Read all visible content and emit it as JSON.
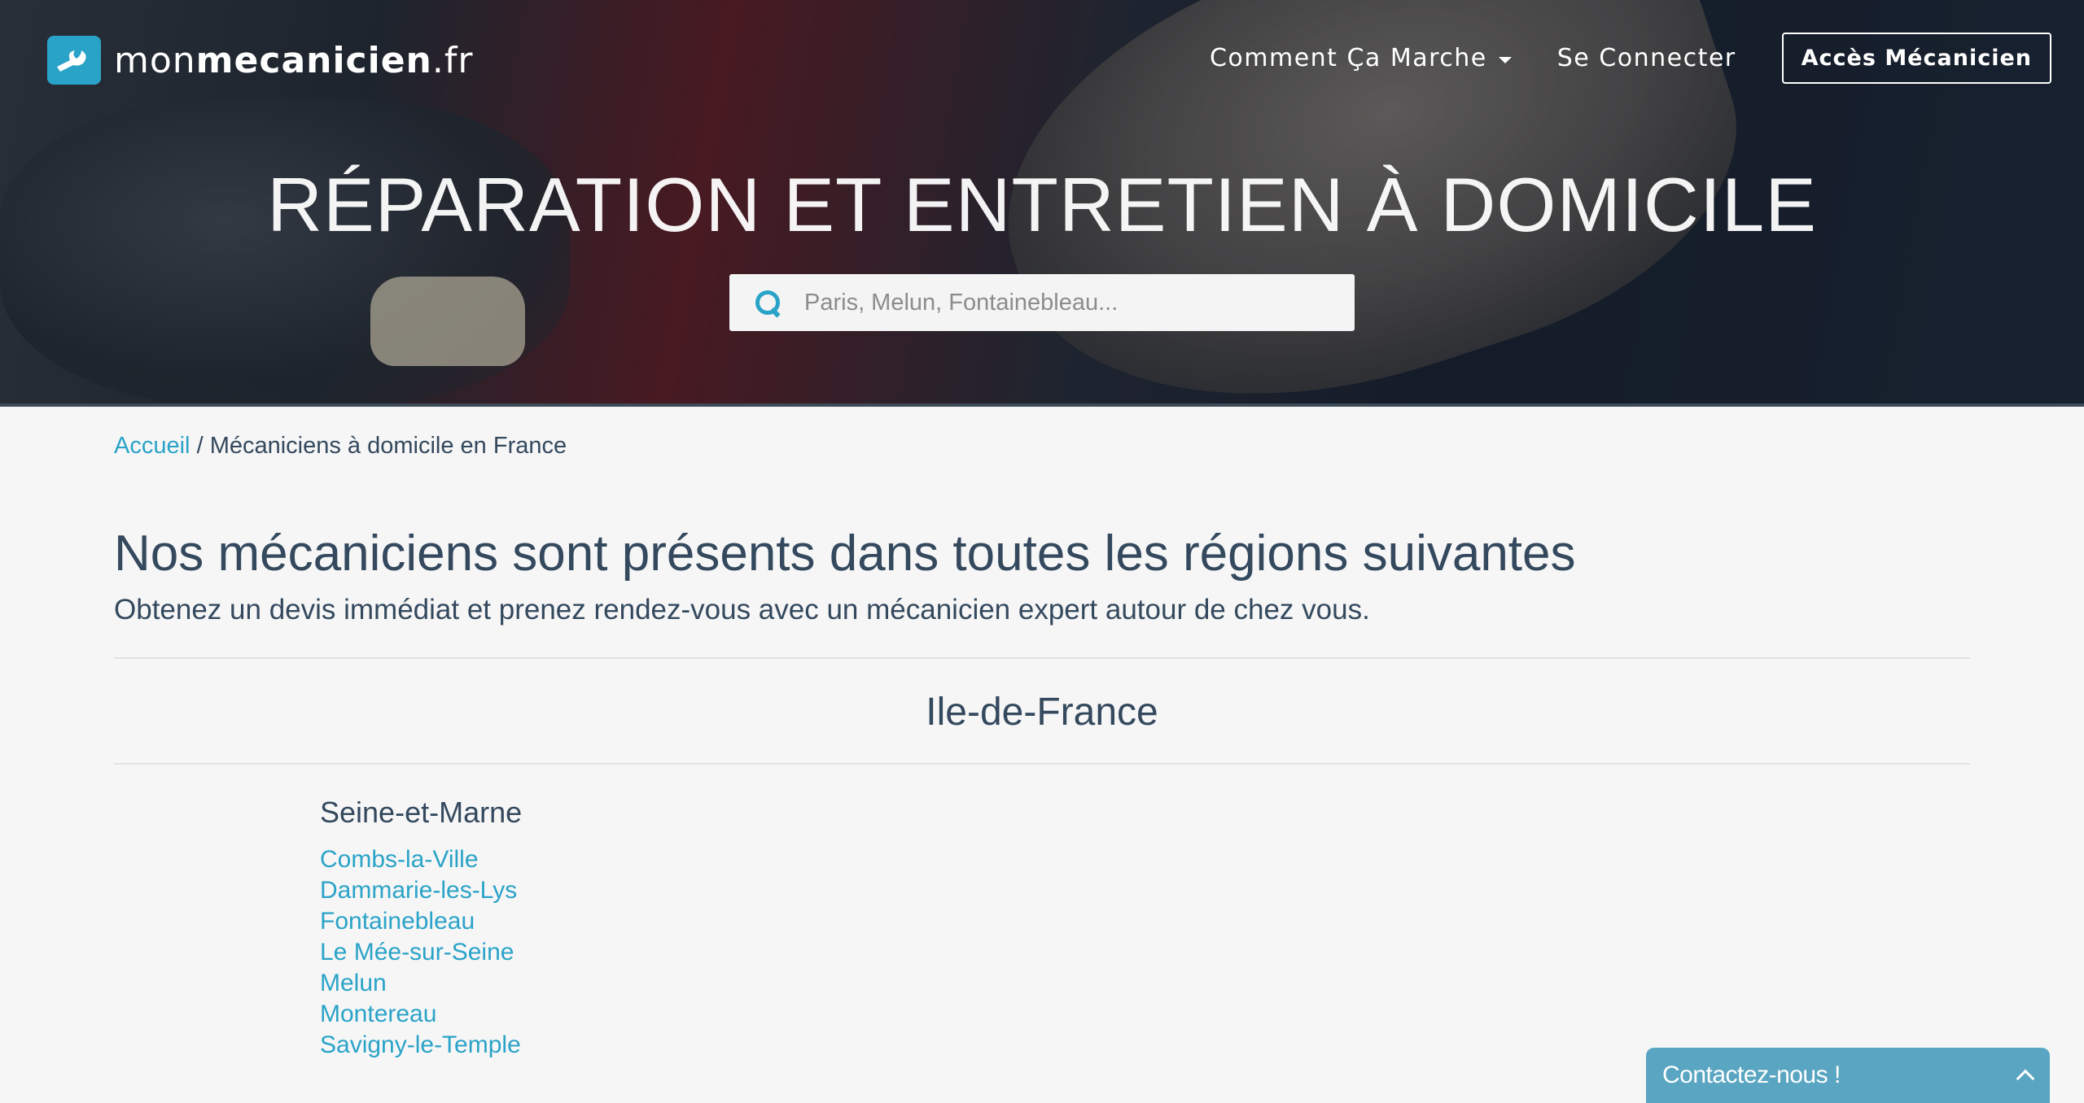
{
  "header": {
    "logo_prefix": "mon",
    "logo_bold": "mecanicien",
    "logo_suffix": ".fr",
    "nav": {
      "how_it_works": "Comment Ça Marche",
      "login": "Se Connecter",
      "mechanic_access": "Accès Mécanicien"
    }
  },
  "hero": {
    "title": "RÉPARATION ET ENTRETIEN À DOMICILE",
    "search_placeholder": "Paris, Melun, Fontainebleau..."
  },
  "breadcrumb": {
    "home": "Accueil",
    "separator": "/",
    "current": "Mécaniciens à domicile en France"
  },
  "main": {
    "heading": "Nos mécaniciens sont présents dans toutes les régions suivantes",
    "subheading": "Obtenez un devis immédiat et prenez rendez-vous avec un mécanicien expert autour de chez vous.",
    "region": "Ile-de-France",
    "department": "Seine-et-Marne",
    "cities": [
      "Combs-la-Ville",
      "Dammarie-les-Lys",
      "Fontainebleau",
      "Le Mée-sur-Seine",
      "Melun",
      "Montereau",
      "Savigny-le-Temple"
    ]
  },
  "contact_widget": {
    "label": "Contactez-nous !"
  },
  "colors": {
    "accent": "#2aa3c8",
    "text": "#34495e",
    "contact_bg": "#5aa6c2"
  }
}
